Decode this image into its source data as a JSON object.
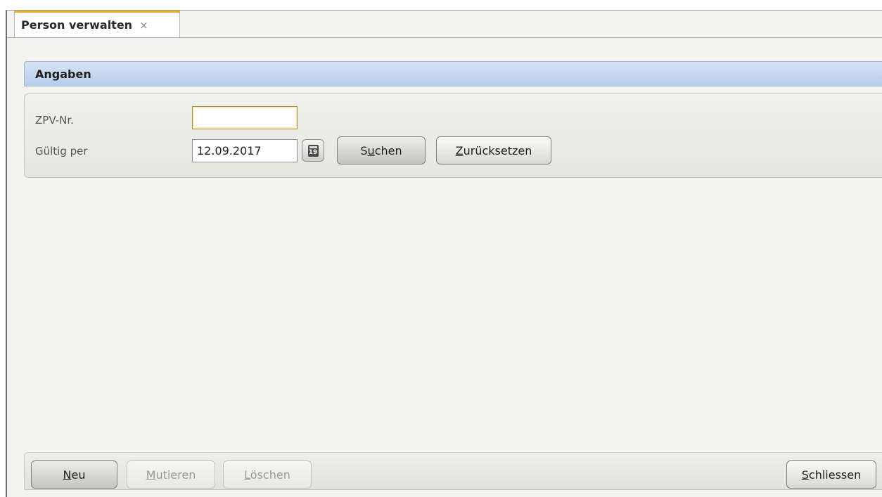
{
  "tab": {
    "title": "Person verwalten",
    "close_symbol": "×"
  },
  "section": {
    "title": "Angaben"
  },
  "form": {
    "zpv_label": "ZPV-Nr.",
    "zpv_value": "",
    "gueltig_label": "Gültig per",
    "gueltig_value": "12.09.2017",
    "calendar_day": "19",
    "search_button": {
      "pre": "S",
      "key": "u",
      "post": "chen"
    },
    "reset_button": {
      "pre": "",
      "key": "Z",
      "post": "urücksetzen"
    }
  },
  "footer": {
    "neu": {
      "pre": "",
      "key": "N",
      "post": "eu"
    },
    "mutieren": {
      "pre": "",
      "key": "M",
      "post": "utieren"
    },
    "loeschen": {
      "pre": "",
      "key": "L",
      "post": "öschen"
    },
    "schliessen": {
      "pre": "",
      "key": "S",
      "post": "chliessen"
    }
  },
  "colors": {
    "tab_accent": "#f0ab2b",
    "section_header": "#c4d6ee",
    "background": "#f3f3ef"
  }
}
